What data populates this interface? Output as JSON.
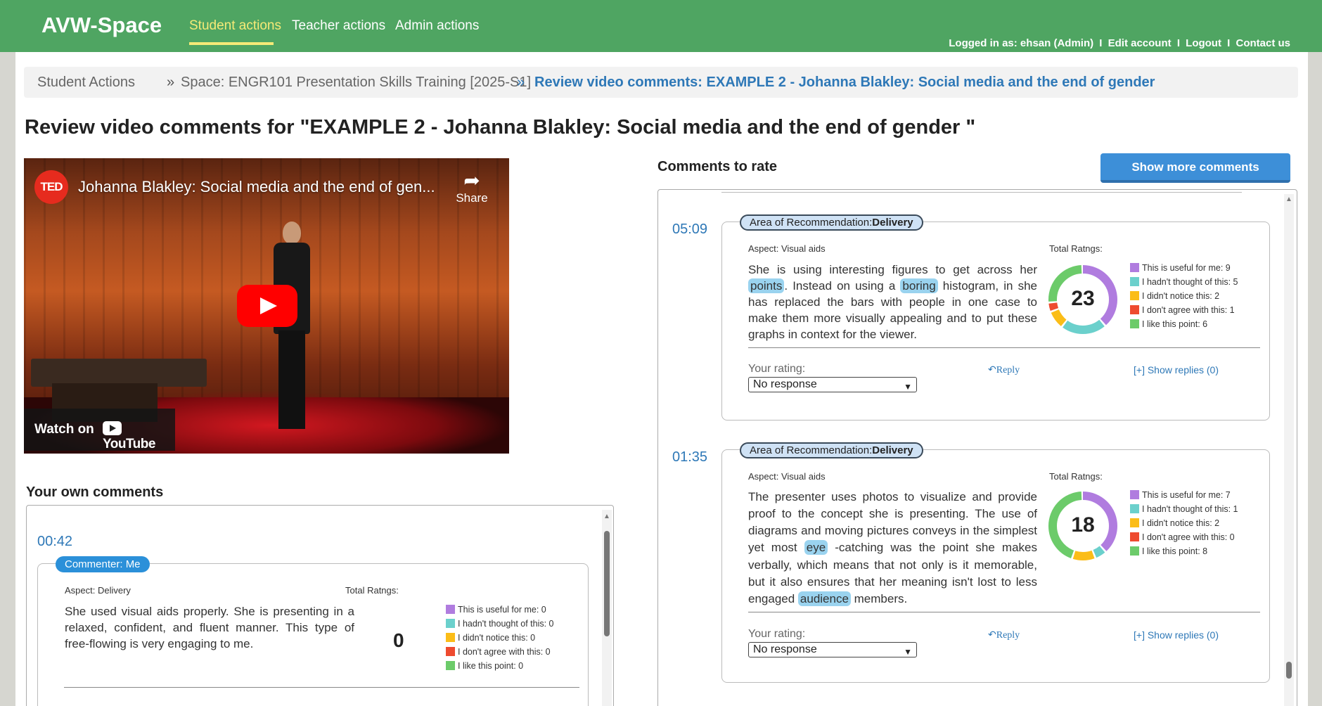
{
  "nav": {
    "brand": "AVW-Space",
    "links": [
      "Student actions",
      "Teacher actions",
      "Admin actions"
    ],
    "login_text": "Logged in as: ehsan (Admin)",
    "edit_account": "Edit account",
    "logout": "Logout",
    "contact": "Contact us",
    "sep": "I"
  },
  "breadcrumb": {
    "items": [
      "Student Actions",
      "Space: ENGR101 Presentation Skills Training [2025-S1]",
      "Review video comments: EXAMPLE 2 - Johanna Blakley: Social media and the end of gender"
    ],
    "sep": "»"
  },
  "page_title": "Review video comments for \"EXAMPLE 2 - Johanna Blakley: Social media and the end of gender \"",
  "video": {
    "channel_logo": "TED",
    "title": "Johanna Blakley: Social media and the end of gen...",
    "share_label": "Share",
    "watch_on": "Watch on",
    "youtube": "YouTube"
  },
  "own_comments": {
    "heading": "Your own comments",
    "comment": {
      "time": "00:42",
      "tag": "Commenter: Me",
      "aspect": "Aspect: Delivery",
      "total_label": "Total Ratngs:",
      "total": "0",
      "text": "She used visual aids properly. She is presenting in a relaxed, confident, and fluent manner. This type of free-flowing is very engaging to me.",
      "legend": [
        "This is useful for me: 0",
        "I hadn't thought of this: 0",
        "I didn't notice this: 0",
        "I don't agree with this: 0",
        "I like this point: 0"
      ]
    }
  },
  "rate": {
    "heading": "Comments to rate",
    "show_more": "Show more comments",
    "rating_label": "Your rating:",
    "rating_value": "No response",
    "reply": "Reply",
    "show_replies": "[+] Show replies (0)",
    "tag_prefix": "Area of Recommendation:",
    "comments": [
      {
        "time": "05:09",
        "area": "Delivery",
        "aspect": "Aspect: Visual aids",
        "total_label": "Total Ratngs:",
        "total": "23",
        "text": {
          "t1": "She is using interesting figures to get across her ",
          "k1": "points",
          "t2": ". Instead on using a ",
          "k2": "boring",
          "t3": " histogram, in she has replaced the bars with people in one case to make them more visually appealing and to put these graphs in context for the viewer."
        },
        "legend": [
          "This is useful for me: 9",
          "I hadn't thought of this: 5",
          "I didn't notice this: 2",
          "I don't agree with this: 1",
          "I like this point: 6"
        ],
        "ratings": [
          9,
          5,
          2,
          1,
          6
        ]
      },
      {
        "time": "01:35",
        "area": "Delivery",
        "aspect": "Aspect: Visual aids",
        "total_label": "Total Ratngs:",
        "total": "18",
        "text": {
          "t1": "The presenter uses photos to visualize and provide proof to the concept she is presenting. The use of diagrams and moving pictures conveys in the simplest yet most ",
          "k1": "eye",
          "t2": " -catching was the point she makes verbally, which means that not only is it memorable, but it also ensures that her meaning isn't lost to less engaged ",
          "k2": "audience",
          "t3": " members."
        },
        "legend": [
          "This is useful for me: 7",
          "I hadn't thought of this: 1",
          "I didn't notice this: 2",
          "I don't agree with this: 0",
          "I like this point: 8"
        ],
        "ratings": [
          7,
          1,
          2,
          0,
          8
        ]
      }
    ]
  },
  "colors": {
    "nav_bg": "#4fa562",
    "accent": "#2e78b7",
    "useful": "#b07cdf",
    "not_thought": "#6bd0cc",
    "not_notice": "#fbbd18",
    "disagree": "#ee4b2f",
    "like": "#6ccb6a"
  }
}
